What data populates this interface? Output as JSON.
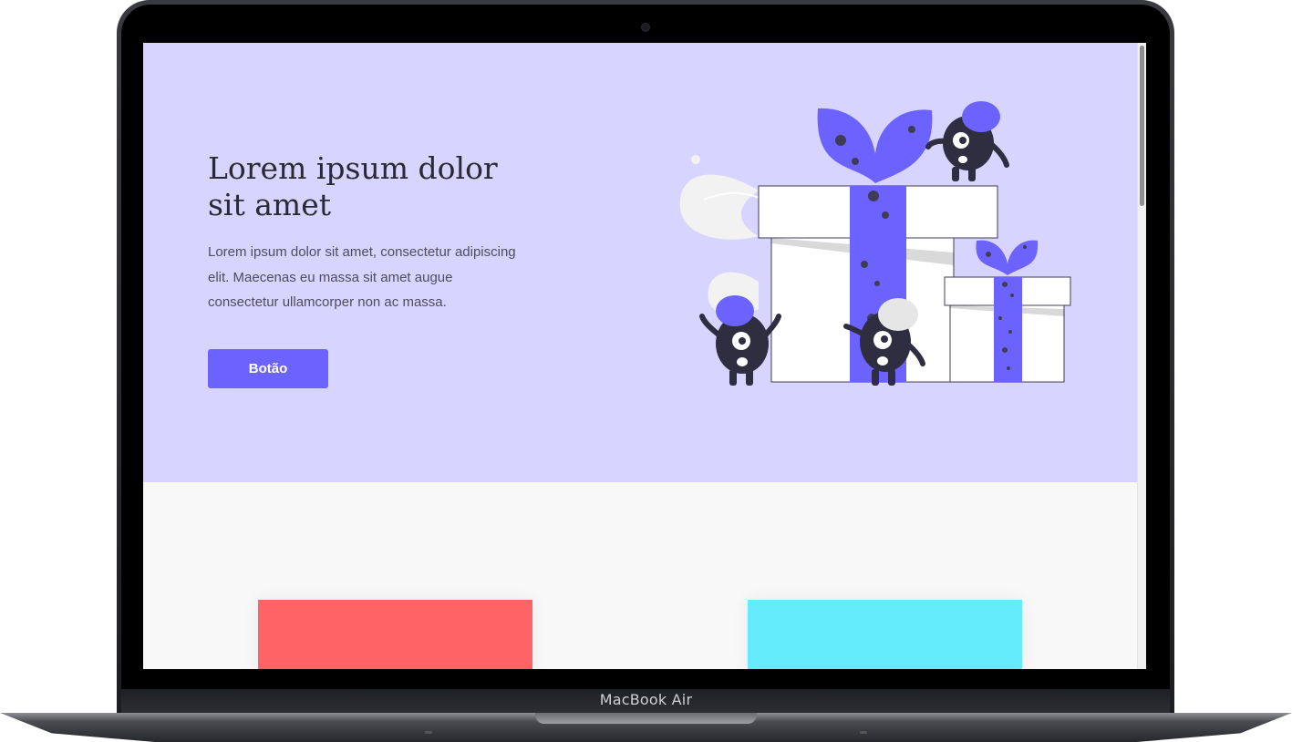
{
  "device": {
    "label": "MacBook Air"
  },
  "hero": {
    "title": "Lorem ipsum dolor sit amet",
    "text": "Lorem ipsum dolor sit amet, consectetur adipiscing elit. Maecenas eu massa sit amet augue consectetur ullamcorper non ac massa.",
    "button_label": "Botão",
    "illustration_icon": "gift-boxes-with-monsters-illustration"
  },
  "colors": {
    "hero_background": "#d7d4ff",
    "accent": "#6c63ff",
    "card_red": "#ff6366",
    "card_cyan": "#64ecfd",
    "page_background": "#f8f8f9"
  },
  "cards": [
    {
      "color": "#ff6366"
    },
    {
      "color": "#64ecfd"
    }
  ]
}
